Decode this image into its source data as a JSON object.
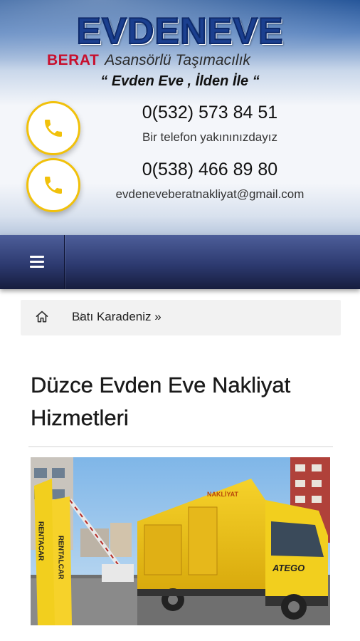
{
  "header": {
    "logo_main": "EVDENEVE",
    "logo_brand": "BERAT",
    "logo_tagline": "Asansörlü Taşımacılık",
    "slogan": "“ Evden Eve , İlden İle “",
    "contacts": [
      {
        "icon": "phone-icon",
        "value": "0(532) 573 84 51",
        "caption": "Bir telefon yakınınızdayız"
      },
      {
        "icon": "phone-icon",
        "value": "0(538) 466 89 80",
        "caption": "evdeneveberatnakliyat@gmail.com"
      }
    ]
  },
  "nav": {
    "menu_icon": "hamburger-menu-icon"
  },
  "breadcrumb": {
    "home_icon": "home-icon",
    "separator": "/",
    "items": [
      {
        "label": "Batı Karadeniz »"
      }
    ]
  },
  "article": {
    "title": "Düzce Evden Eve Nakliyat Hizmetleri",
    "image": {
      "truck_label": "ATEGO",
      "tower_text": "RENTACAR",
      "tower_text_2": "RENTALCAR",
      "truck_sign": "NAKLİYAT"
    }
  },
  "colors": {
    "logo_blue": "#1b3f8f",
    "brand_red": "#c8102e",
    "badge_yellow": "#f1c10b",
    "nav_dark": "#2d3a70"
  }
}
